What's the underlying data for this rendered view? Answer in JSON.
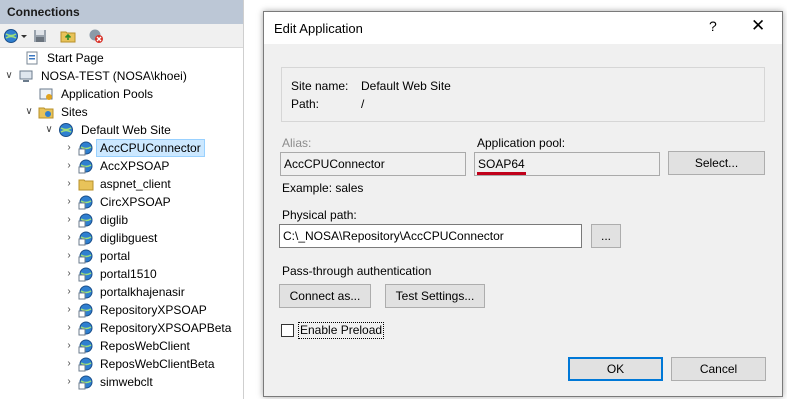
{
  "connections": {
    "title": "Connections",
    "tree": [
      {
        "label": "Start Page",
        "icon": "start-page-icon",
        "level": 0
      },
      {
        "label": "NOSA-TEST (NOSA\\khoei)",
        "icon": "server-icon",
        "level": 0
      },
      {
        "label": "Application Pools",
        "icon": "app-pools-icon",
        "level": 1
      },
      {
        "label": "Sites",
        "icon": "sites-folder-icon",
        "level": 1
      },
      {
        "label": "Default Web Site",
        "icon": "globe-icon",
        "level": 2
      },
      {
        "label": "AccCPUConnector",
        "icon": "application-icon",
        "level": 3,
        "selected": true
      },
      {
        "label": "AccXPSOAP",
        "icon": "application-icon",
        "level": 3
      },
      {
        "label": "aspnet_client",
        "icon": "folder-icon",
        "level": 3
      },
      {
        "label": "CircXPSOAP",
        "icon": "application-icon",
        "level": 3
      },
      {
        "label": "diglib",
        "icon": "application-icon",
        "level": 3
      },
      {
        "label": "diglibguest",
        "icon": "application-icon",
        "level": 3
      },
      {
        "label": "portal",
        "icon": "application-icon",
        "level": 3
      },
      {
        "label": "portal1510",
        "icon": "application-icon",
        "level": 3
      },
      {
        "label": "portalkhajenasir",
        "icon": "application-icon",
        "level": 3
      },
      {
        "label": "RepositoryXPSOAP",
        "icon": "application-icon",
        "level": 3
      },
      {
        "label": "RepositoryXPSOAPBeta",
        "icon": "application-icon",
        "level": 3
      },
      {
        "label": "ReposWebClient",
        "icon": "application-icon",
        "level": 3
      },
      {
        "label": "ReposWebClientBeta",
        "icon": "application-icon",
        "level": 3
      },
      {
        "label": "simwebclt",
        "icon": "application-icon",
        "level": 3
      }
    ]
  },
  "dialog": {
    "title": "Edit Application",
    "help": "?",
    "close": "✕",
    "site_name_label": "Site name:",
    "site_name_value": "Default Web Site",
    "path_label": "Path:",
    "path_value": "/",
    "alias_label": "Alias:",
    "alias_value": "AccCPUConnector",
    "example": "Example: sales",
    "app_pool_label": "Application pool:",
    "app_pool_value": "SOAP64",
    "select_button": "Select...",
    "physical_path_label": "Physical path:",
    "physical_path_value": "C:\\_NOSA\\Repository\\AccCPUConnector",
    "browse_button": "...",
    "passthrough_label": "Pass-through authentication",
    "connect_as_button": "Connect as...",
    "test_settings_button": "Test Settings...",
    "enable_preload_label": "Enable Preload",
    "enable_preload_checked": false,
    "ok_button": "OK",
    "cancel_button": "Cancel"
  },
  "colors": {
    "accent": "#0078d7",
    "panel_title": "#bcc7d6",
    "underline": "#c0001a",
    "selection": "#cce8ff"
  }
}
